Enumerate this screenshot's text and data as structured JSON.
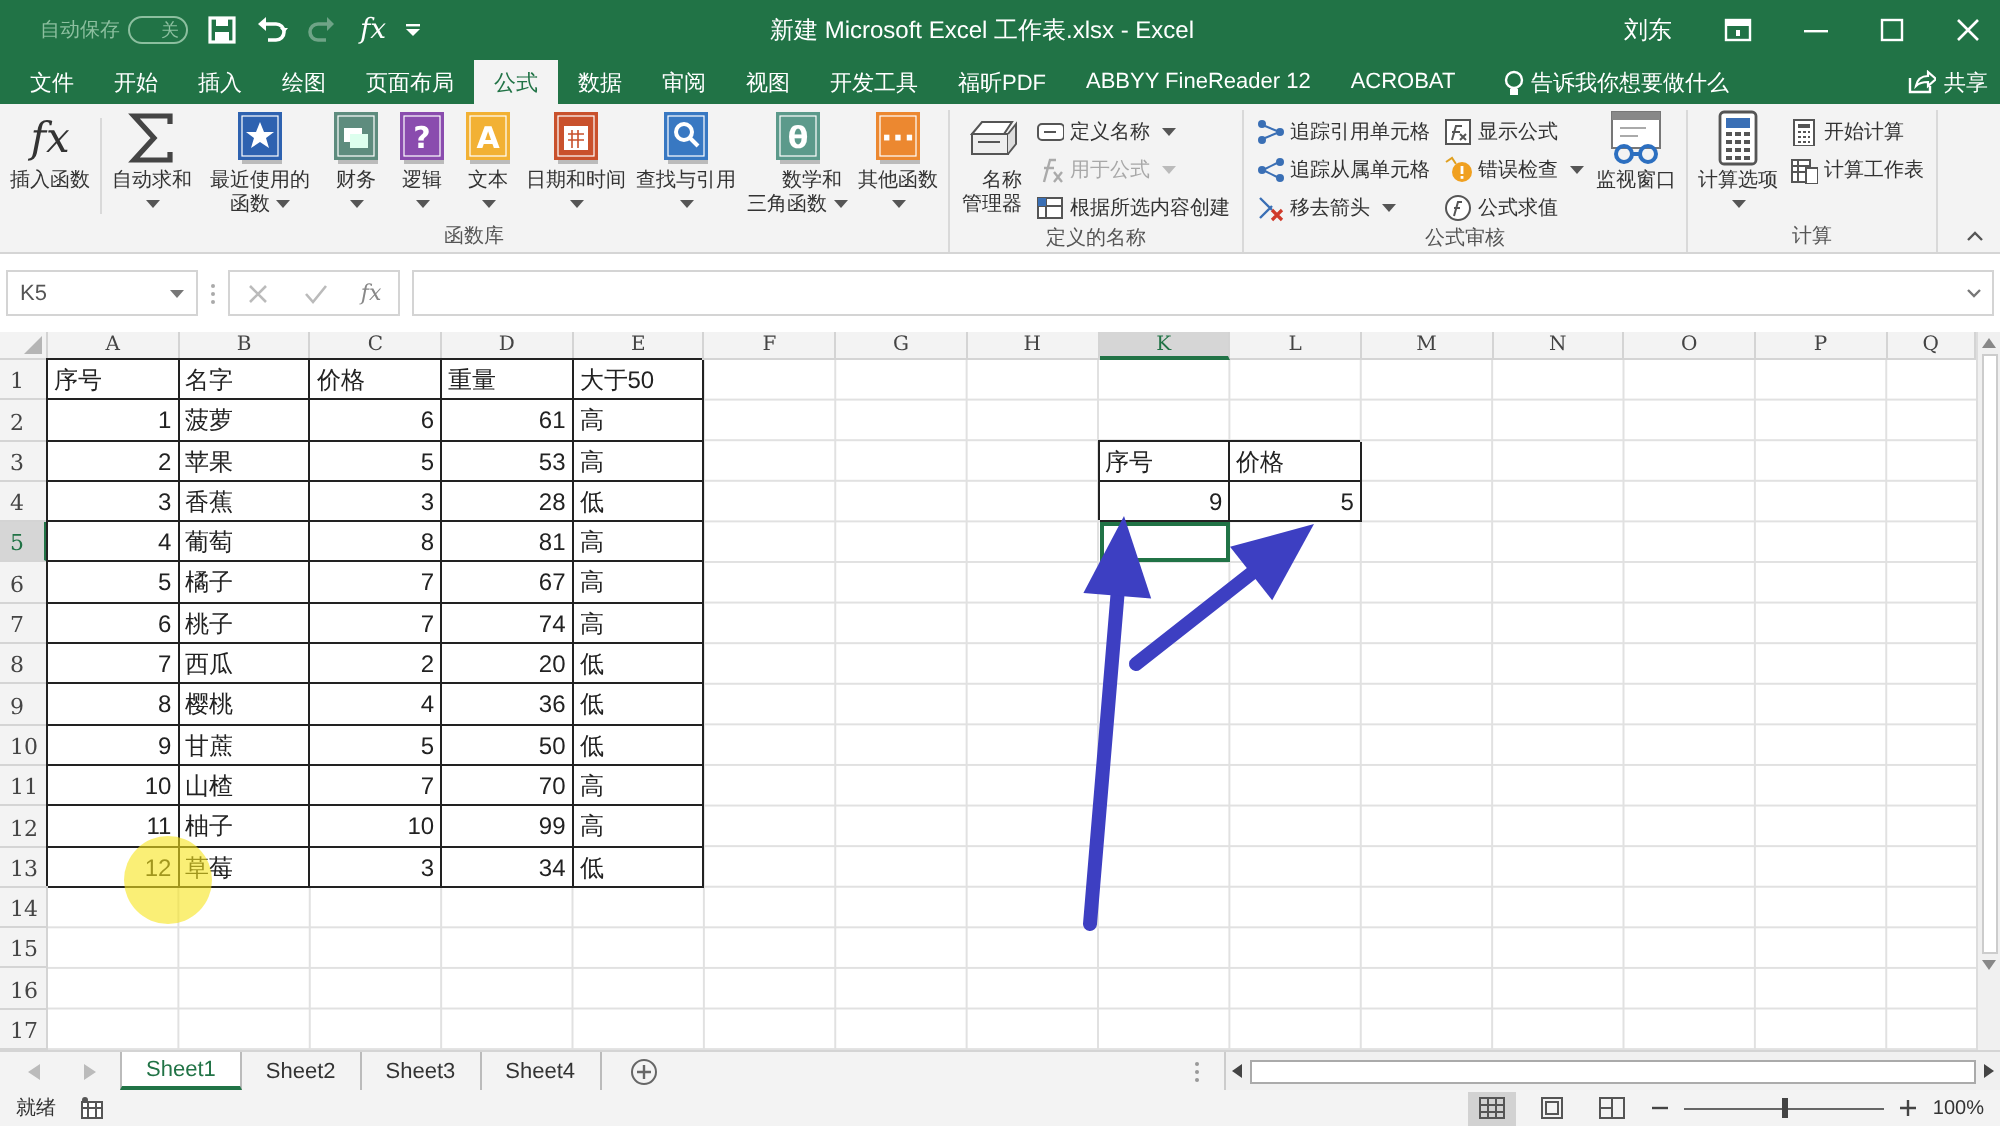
{
  "window": {
    "title": "新建 Microsoft Excel 工作表.xlsx  -  Excel",
    "user": "刘东"
  },
  "quick_access": {
    "autosave_label": "自动保存",
    "autosave_state": "关",
    "autosave_on": false,
    "formula_glyph": "fx"
  },
  "ribbon_tabs": [
    {
      "label": "文件",
      "selected": false
    },
    {
      "label": "开始",
      "selected": false
    },
    {
      "label": "插入",
      "selected": false
    },
    {
      "label": "绘图",
      "selected": false
    },
    {
      "label": "页面布局",
      "selected": false
    },
    {
      "label": "公式",
      "selected": true
    },
    {
      "label": "数据",
      "selected": false
    },
    {
      "label": "审阅",
      "selected": false
    },
    {
      "label": "视图",
      "selected": false
    },
    {
      "label": "开发工具",
      "selected": false
    },
    {
      "label": "福昕PDF",
      "selected": false
    },
    {
      "label": "ABBYY FineReader 12",
      "selected": false
    },
    {
      "label": "ACROBAT",
      "selected": false
    }
  ],
  "tell_me": "告诉我你想要做什么",
  "share": "共享",
  "ribbon_groups": [
    {
      "label": "函数库",
      "items": [
        {
          "kind": "large",
          "label": "插入函数",
          "dropdown": false,
          "glyph": "fx"
        },
        {
          "kind": "separator"
        },
        {
          "kind": "large",
          "label": "自动求和",
          "dropdown": true
        },
        {
          "kind": "large",
          "label": "最近使用的函数",
          "dropdown": true,
          "color": "#2e62b0"
        },
        {
          "kind": "large",
          "label": "财务",
          "dropdown": true,
          "color": "#5e8c7e"
        },
        {
          "kind": "large",
          "label": "逻辑",
          "dropdown": true,
          "color": "#8a4cae",
          "glyph": "?"
        },
        {
          "kind": "large",
          "label": "文本",
          "dropdown": true,
          "color": "#f2b134",
          "glyph": "A"
        },
        {
          "kind": "large",
          "label": "日期和时间",
          "dropdown": true,
          "color": "#c9512c"
        },
        {
          "kind": "large",
          "label": "查找与引用",
          "dropdown": true,
          "color": "#3878c2"
        },
        {
          "kind": "large",
          "label": "数学和三角函数",
          "dropdown": true,
          "color": "#5c9a8b",
          "glyph": "θ"
        },
        {
          "kind": "large",
          "label": "其他函数",
          "dropdown": true,
          "color": "#ec8830",
          "glyph": "···"
        }
      ]
    },
    {
      "label": "定义的名称",
      "items": [
        {
          "kind": "large",
          "label": "名称管理器",
          "dropdown": false
        },
        {
          "kind": "stack",
          "items": [
            {
              "label": "定义名称",
              "dropdown": true,
              "disabled": false
            },
            {
              "label": "用于公式",
              "dropdown": true,
              "disabled": true
            },
            {
              "label": "根据所选内容创建",
              "dropdown": false,
              "disabled": false
            }
          ]
        }
      ]
    },
    {
      "label": "公式审核",
      "items": [
        {
          "kind": "stack",
          "items": [
            {
              "label": "追踪引用单元格",
              "dropdown": false,
              "disabled": false
            },
            {
              "label": "追踪从属单元格",
              "dropdown": false,
              "disabled": false
            },
            {
              "label": "移去箭头",
              "dropdown": true,
              "disabled": false
            }
          ]
        },
        {
          "kind": "stack",
          "items": [
            {
              "label": "显示公式",
              "dropdown": false,
              "disabled": false
            },
            {
              "label": "错误检查",
              "dropdown": true,
              "disabled": false
            },
            {
              "label": "公式求值",
              "dropdown": false,
              "disabled": false
            }
          ]
        },
        {
          "kind": "large",
          "label": "监视窗口",
          "dropdown": false
        }
      ]
    },
    {
      "label": "计算",
      "items": [
        {
          "kind": "large",
          "label": "计算选项",
          "dropdown": true
        },
        {
          "kind": "stack",
          "items": [
            {
              "label": "开始计算",
              "dropdown": false,
              "disabled": false
            },
            {
              "label": "计算工作表",
              "dropdown": false,
              "disabled": false
            }
          ]
        }
      ]
    }
  ],
  "formula_bar": {
    "name_box": "K5",
    "glyph": "fx"
  },
  "sheet": {
    "columns": [
      {
        "label": "A",
        "selected": false
      },
      {
        "label": "B",
        "selected": false
      },
      {
        "label": "C",
        "selected": false
      },
      {
        "label": "D",
        "selected": false
      },
      {
        "label": "E",
        "selected": false
      },
      {
        "label": "F",
        "selected": false
      },
      {
        "label": "G",
        "selected": false
      },
      {
        "label": "H",
        "selected": false
      },
      {
        "label": "K",
        "selected": true
      },
      {
        "label": "L",
        "selected": false
      },
      {
        "label": "M",
        "selected": false
      },
      {
        "label": "N",
        "selected": false
      },
      {
        "label": "O",
        "selected": false
      },
      {
        "label": "P",
        "selected": false
      },
      {
        "label": "Q",
        "selected": false
      }
    ],
    "rows": [
      {
        "header": "1",
        "selected": false,
        "cells": {
          "A": {
            "text": "序号",
            "kind": "text"
          },
          "B": {
            "text": "名字",
            "kind": "text"
          },
          "C": {
            "text": "价格",
            "kind": "text"
          },
          "D": {
            "text": "重量",
            "kind": "text"
          },
          "E": {
            "text": "大于50",
            "kind": "text"
          }
        }
      },
      {
        "header": "2",
        "selected": false,
        "cells": {
          "A": {
            "text": "1",
            "kind": "number"
          },
          "B": {
            "text": "菠萝",
            "kind": "text"
          },
          "C": {
            "text": "6",
            "kind": "number"
          },
          "D": {
            "text": "61",
            "kind": "number"
          },
          "E": {
            "text": "高",
            "kind": "text"
          }
        }
      },
      {
        "header": "3",
        "selected": false,
        "cells": {
          "A": {
            "text": "2",
            "kind": "number"
          },
          "B": {
            "text": "苹果",
            "kind": "text"
          },
          "C": {
            "text": "5",
            "kind": "number"
          },
          "D": {
            "text": "53",
            "kind": "number"
          },
          "E": {
            "text": "高",
            "kind": "text"
          },
          "K": {
            "text": "序号",
            "kind": "text"
          },
          "L": {
            "text": "价格",
            "kind": "text"
          }
        }
      },
      {
        "header": "4",
        "selected": false,
        "cells": {
          "A": {
            "text": "3",
            "kind": "number"
          },
          "B": {
            "text": "香蕉",
            "kind": "text"
          },
          "C": {
            "text": "3",
            "kind": "number"
          },
          "D": {
            "text": "28",
            "kind": "number"
          },
          "E": {
            "text": "低",
            "kind": "text"
          },
          "K": {
            "text": "9",
            "kind": "number"
          },
          "L": {
            "text": "5",
            "kind": "number"
          }
        }
      },
      {
        "header": "5",
        "selected": true,
        "cells": {
          "A": {
            "text": "4",
            "kind": "number"
          },
          "B": {
            "text": "葡萄",
            "kind": "text"
          },
          "C": {
            "text": "8",
            "kind": "number"
          },
          "D": {
            "text": "81",
            "kind": "number"
          },
          "E": {
            "text": "高",
            "kind": "text"
          }
        }
      },
      {
        "header": "6",
        "selected": false,
        "cells": {
          "A": {
            "text": "5",
            "kind": "number"
          },
          "B": {
            "text": "橘子",
            "kind": "text"
          },
          "C": {
            "text": "7",
            "kind": "number"
          },
          "D": {
            "text": "67",
            "kind": "number"
          },
          "E": {
            "text": "高",
            "kind": "text"
          }
        }
      },
      {
        "header": "7",
        "selected": false,
        "cells": {
          "A": {
            "text": "6",
            "kind": "number"
          },
          "B": {
            "text": "桃子",
            "kind": "text"
          },
          "C": {
            "text": "7",
            "kind": "number"
          },
          "D": {
            "text": "74",
            "kind": "number"
          },
          "E": {
            "text": "高",
            "kind": "text"
          }
        }
      },
      {
        "header": "8",
        "selected": false,
        "cells": {
          "A": {
            "text": "7",
            "kind": "number"
          },
          "B": {
            "text": "西瓜",
            "kind": "text"
          },
          "C": {
            "text": "2",
            "kind": "number"
          },
          "D": {
            "text": "20",
            "kind": "number"
          },
          "E": {
            "text": "低",
            "kind": "text"
          }
        }
      },
      {
        "header": "9",
        "selected": false,
        "cells": {
          "A": {
            "text": "8",
            "kind": "number"
          },
          "B": {
            "text": "樱桃",
            "kind": "text"
          },
          "C": {
            "text": "4",
            "kind": "number"
          },
          "D": {
            "text": "36",
            "kind": "number"
          },
          "E": {
            "text": "低",
            "kind": "text"
          }
        }
      },
      {
        "header": "10",
        "selected": false,
        "cells": {
          "A": {
            "text": "9",
            "kind": "number"
          },
          "B": {
            "text": "甘蔗",
            "kind": "text"
          },
          "C": {
            "text": "5",
            "kind": "number"
          },
          "D": {
            "text": "50",
            "kind": "number"
          },
          "E": {
            "text": "低",
            "kind": "text"
          }
        }
      },
      {
        "header": "11",
        "selected": false,
        "cells": {
          "A": {
            "text": "10",
            "kind": "number"
          },
          "B": {
            "text": "山楂",
            "kind": "text"
          },
          "C": {
            "text": "7",
            "kind": "number"
          },
          "D": {
            "text": "70",
            "kind": "number"
          },
          "E": {
            "text": "高",
            "kind": "text"
          }
        }
      },
      {
        "header": "12",
        "selected": false,
        "cells": {
          "A": {
            "text": "11",
            "kind": "number"
          },
          "B": {
            "text": "柚子",
            "kind": "text"
          },
          "C": {
            "text": "10",
            "kind": "number"
          },
          "D": {
            "text": "99",
            "kind": "number"
          },
          "E": {
            "text": "高",
            "kind": "text"
          }
        }
      },
      {
        "header": "13",
        "selected": false,
        "cells": {
          "A": {
            "text": "12",
            "kind": "number"
          },
          "B": {
            "text": "草莓",
            "kind": "text"
          },
          "C": {
            "text": "3",
            "kind": "number"
          },
          "D": {
            "text": "34",
            "kind": "number"
          },
          "E": {
            "text": "低",
            "kind": "text"
          }
        }
      },
      {
        "header": "14",
        "selected": false,
        "cells": {}
      },
      {
        "header": "15",
        "selected": false,
        "cells": {}
      },
      {
        "header": "16",
        "selected": false,
        "cells": {}
      },
      {
        "header": "17",
        "selected": false,
        "cells": {}
      }
    ]
  },
  "sheet_tabs": [
    {
      "label": "Sheet1",
      "selected": true
    },
    {
      "label": "Sheet2",
      "selected": false
    },
    {
      "label": "Sheet3",
      "selected": false
    },
    {
      "label": "Sheet4",
      "selected": false
    }
  ],
  "status_bar": {
    "status": "就绪",
    "views": [
      {
        "selected": true
      },
      {
        "selected": false
      },
      {
        "selected": false
      }
    ],
    "zoom": {
      "level": 0.5,
      "reading": "100%"
    }
  },
  "annotations": [
    {
      "kind": "arrow"
    },
    {
      "kind": "arrow"
    },
    {
      "kind": "cursor-highlight"
    }
  ]
}
